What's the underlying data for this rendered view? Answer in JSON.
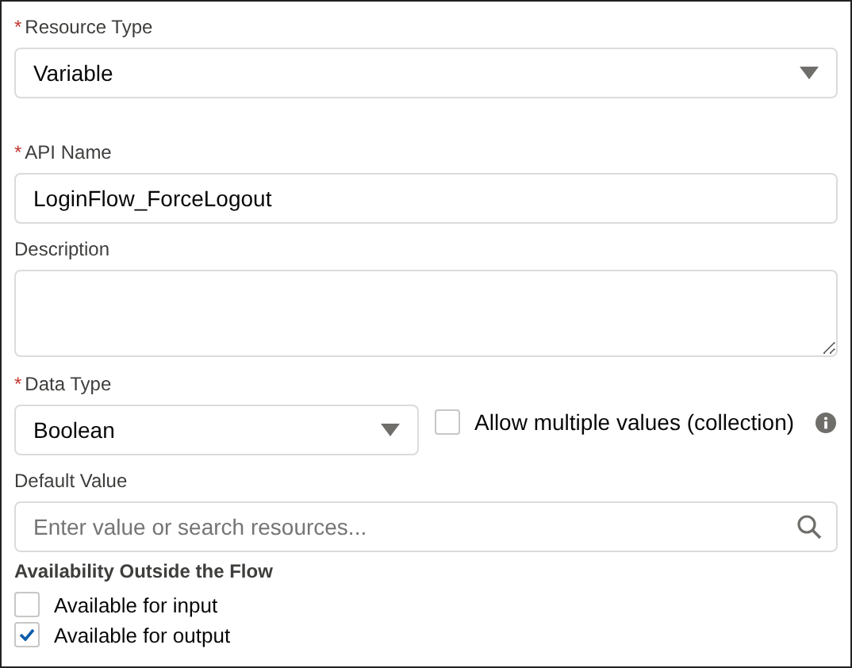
{
  "resource_type": {
    "label": "Resource Type",
    "required_mark": "*",
    "value": "Variable"
  },
  "api_name": {
    "label": "API Name",
    "required_mark": "*",
    "value": "LoginFlow_ForceLogout"
  },
  "description": {
    "label": "Description"
  },
  "data_type": {
    "label": "Data Type",
    "required_mark": "*",
    "value": "Boolean",
    "collection": {
      "label": "Allow multiple values (collection)",
      "checked": false
    }
  },
  "default_value": {
    "label": "Default Value",
    "placeholder": "Enter value or search resources..."
  },
  "availability": {
    "heading": "Availability Outside the Flow",
    "options": [
      {
        "label": "Available for input",
        "checked": false
      },
      {
        "label": "Available for output",
        "checked": true
      }
    ]
  }
}
